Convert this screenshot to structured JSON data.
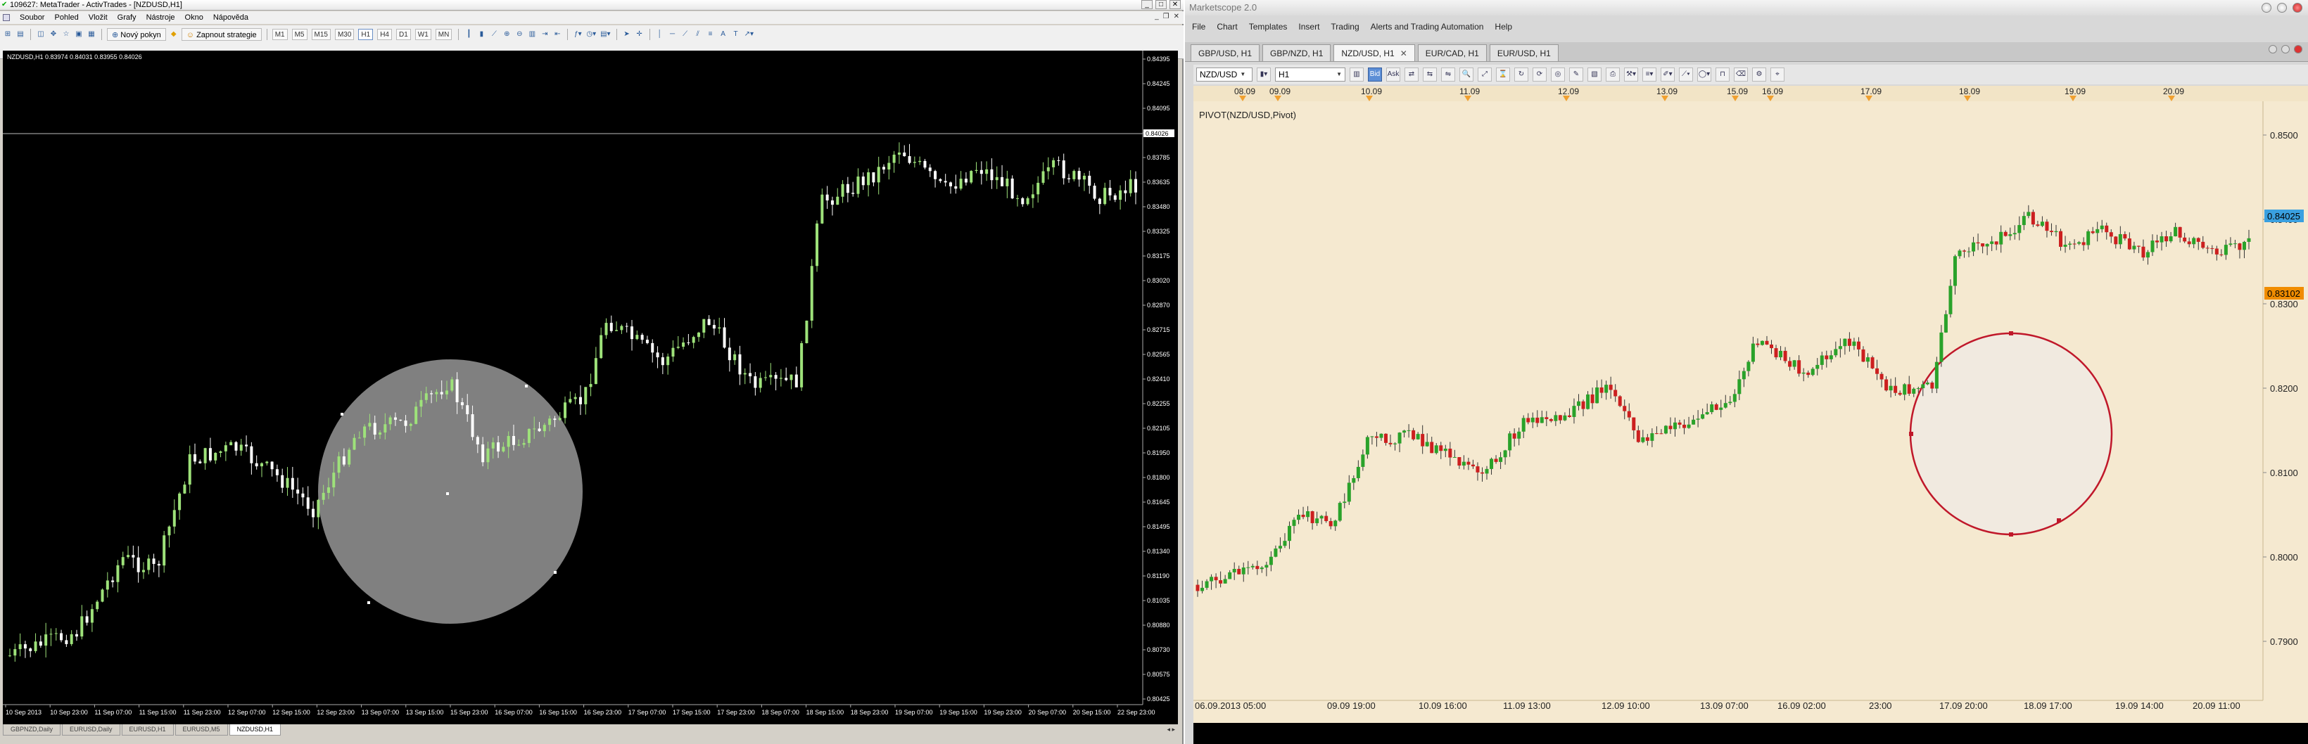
{
  "metatrader": {
    "title": "109627: MetaTrader - ActivTrades - [NZDUSD,H1]",
    "menu": [
      "Soubor",
      "Pohled",
      "Vložit",
      "Grafy",
      "Nástroje",
      "Okno",
      "Nápověda"
    ],
    "toolbar": {
      "new_order": "Nový pokyn",
      "start_strategy": "Zapnout strategie",
      "timeframes": [
        "M1",
        "M5",
        "M15",
        "M30",
        "H1",
        "H4",
        "D1",
        "W1",
        "MN"
      ],
      "active_timeframe": "H1"
    },
    "chart_info": "NZDUSD,H1  0.83974 0.84031 0.83955 0.84026",
    "price_labels": [
      "0.84395",
      "0.84245",
      "0.84095",
      "0.83940",
      "0.83785",
      "0.83635",
      "0.83480",
      "0.83325",
      "0.83175",
      "0.83020",
      "0.82870",
      "0.82715",
      "0.82565",
      "0.82410",
      "0.82255",
      "0.82105",
      "0.81950",
      "0.81800",
      "0.81645",
      "0.81495",
      "0.81340",
      "0.81190",
      "0.81035",
      "0.80880",
      "0.80730",
      "0.80575",
      "0.80425"
    ],
    "current_price": "0.84026",
    "time_labels": [
      "10 Sep 2013",
      "10 Sep 23:00",
      "11 Sep 07:00",
      "11 Sep 15:00",
      "11 Sep 23:00",
      "12 Sep 07:00",
      "12 Sep 15:00",
      "12 Sep 23:00",
      "13 Sep 07:00",
      "13 Sep 15:00",
      "15 Sep 23:00",
      "16 Sep 07:00",
      "16 Sep 15:00",
      "16 Sep 23:00",
      "17 Sep 07:00",
      "17 Sep 15:00",
      "17 Sep 23:00",
      "18 Sep 07:00",
      "18 Sep 15:00",
      "18 Sep 23:00",
      "19 Sep 07:00",
      "19 Sep 15:00",
      "19 Sep 23:00",
      "20 Sep 07:00",
      "20 Sep 15:00",
      "22 Sep 23:00"
    ],
    "tabs": [
      "GBPNZD,Daily",
      "EURUSD,Daily",
      "EURUSD,H1",
      "EURUSD,M5",
      "NZDUSD,H1"
    ],
    "active_tab": "NZDUSD,H1",
    "colors": {
      "background": "#000000",
      "bull": "#9ee27a",
      "bear": "#ffffff",
      "highlight": "#808080"
    }
  },
  "marketscope": {
    "title": "Marketscope 2.0",
    "menu": [
      "File",
      "Chart",
      "Templates",
      "Insert",
      "Trading",
      "Alerts and Trading Automation",
      "Help"
    ],
    "tabs": [
      "GBP/USD, H1",
      "GBP/NZD, H1",
      "NZD/USD, H1",
      "EUR/CAD, H1",
      "EUR/USD, H1"
    ],
    "active_tab": "NZD/USD, H1",
    "toolbar": {
      "instrument": "NZD/USD",
      "timeframe": "H1",
      "bid": "Bid",
      "ask": "Ask"
    },
    "indicator_label": "PIVOT(NZD/USD,Pivot)",
    "top_dates": [
      "08.09",
      "09.09",
      "10.09",
      "11.09",
      "12.09",
      "13.09",
      "15.09",
      "16.09",
      "17.09",
      "18.09",
      "19.09",
      "20.09"
    ],
    "price_labels": [
      "0.8500",
      "0.8400",
      "0.8300",
      "0.8200",
      "0.8100",
      "0.8000",
      "0.7900"
    ],
    "current_price": "0.84025",
    "pivot_price": "0.83102",
    "bottom_labels": [
      "06.09.2013 05:00",
      "09.09 19:00",
      "10.09 16:00",
      "11.09 13:00",
      "12.09 10:00",
      "13.09 07:00",
      "16.09 02:00",
      "23:00",
      "17.09 20:00",
      "18.09 17:00",
      "19.09 14:00",
      "20.09 11:00"
    ],
    "colors": {
      "background": "#f5e9d0",
      "bull": "#2aa22a",
      "bear": "#cc1f1f",
      "current_label": "#3aa0e0",
      "pivot_label": "#f08c00",
      "circle": "#c0182a"
    }
  }
}
